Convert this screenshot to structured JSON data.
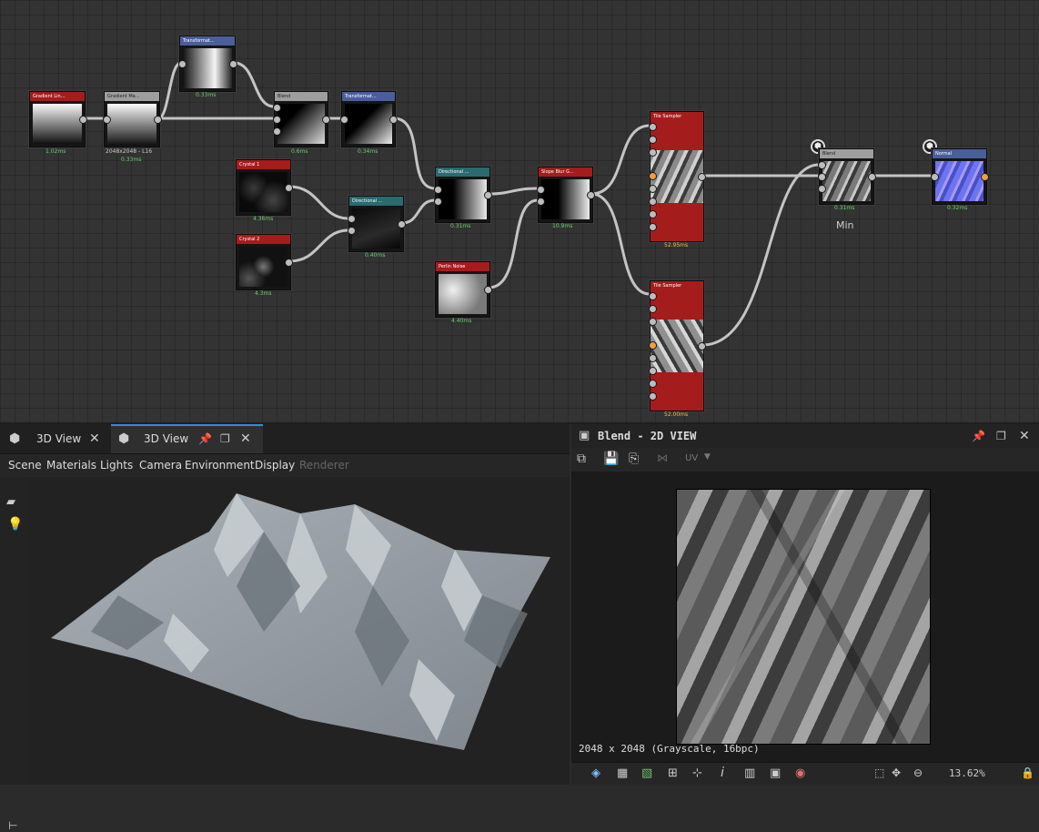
{
  "graph": {
    "nodes": {
      "gradient_linear": {
        "title": "Gradient Lin...",
        "time": "1.02ms"
      },
      "gradient_map": {
        "title": "Gradient Ma...",
        "resolution": "2048x2048 - L16",
        "time": "0.33ms"
      },
      "transform_top": {
        "title": "Transformat...",
        "time": "0.33ms"
      },
      "blend_top": {
        "title": "Blend",
        "time": "0.6ms"
      },
      "transform_mid": {
        "title": "Transformat...",
        "time": "0.34ms"
      },
      "crystal1": {
        "title": "Crystal 1",
        "time": "4.36ms"
      },
      "crystal2": {
        "title": "Crystal 2",
        "time": "4.3ms"
      },
      "directional_a": {
        "title": "Directional ...",
        "time": "0.40ms"
      },
      "directional_b": {
        "title": "Directional ...",
        "time": "0.31ms"
      },
      "slope_blur": {
        "title": "Slope Blur G...",
        "time": "10.9ms"
      },
      "perlin_noise": {
        "title": "Perlin Noise",
        "time": "4.40ms"
      },
      "tile_sampler_1": {
        "title": "Tile Sampler",
        "time": "52.95ms"
      },
      "tile_sampler_2": {
        "title": "Tile Sampler",
        "time": "52.00ms"
      },
      "blend_min": {
        "title": "Blend",
        "time": "0.31ms",
        "mode": "Min"
      },
      "normal": {
        "title": "Normal",
        "time": "0.32ms"
      }
    }
  },
  "left_panel": {
    "tabs": [
      {
        "label": "3D View",
        "active": false
      },
      {
        "label": "3D View",
        "active": true
      }
    ],
    "menu": [
      "Scene",
      "Materials",
      "Lights",
      "Camera",
      "Environment",
      "Display",
      "Renderer"
    ]
  },
  "right_panel": {
    "title": "Blend - 2D VIEW",
    "uv_label": "UV",
    "info": "2048 x 2048 (Grayscale, 16bpc)",
    "zoom": "13.62%"
  },
  "colors": {
    "accent": "#3d86e8",
    "node_red": "#a51c1c",
    "node_blue": "#4a5f99",
    "node_teal": "#2b6a6e",
    "node_gray": "#9e9e9e",
    "time_green": "#6bd16b"
  }
}
